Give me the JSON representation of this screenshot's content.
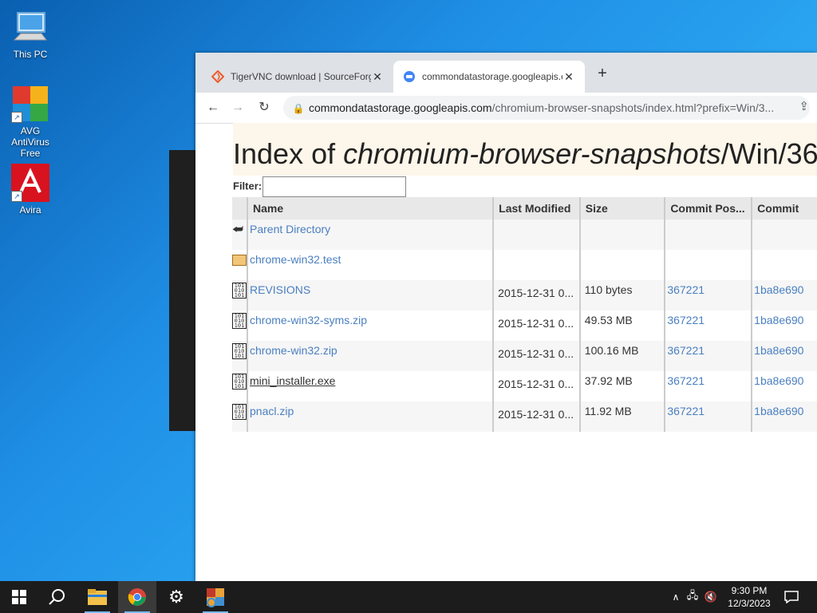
{
  "desktop": {
    "icons": [
      {
        "label": "This PC",
        "icon": "computer-icon"
      },
      {
        "label": "AVG AntiVirus Free",
        "icon": "avg-icon"
      },
      {
        "label": "Avira",
        "icon": "avira-icon"
      }
    ]
  },
  "browser": {
    "tabs": [
      {
        "title": "TigerVNC download | SourceForge",
        "icon": "sourceforge-icon",
        "active": false
      },
      {
        "title": "commondatastorage.googleapis.com",
        "icon": "globe-icon",
        "active": true
      }
    ],
    "address": {
      "host": "commondatastorage.googleapis.com",
      "path": "/chromium-browser-snapshots/index.html?prefix=Win/3..."
    },
    "page": {
      "title_prefix": "Index of ",
      "title_italic": "chromium-browser-snapshots",
      "title_suffix": "/Win/36",
      "filter_label": "Filter:",
      "filter_value": "",
      "columns": [
        "Name",
        "Last Modified",
        "Size",
        "Commit Pos...",
        "Commit"
      ],
      "rows": [
        {
          "icon": "back-arrow-icon",
          "name": "Parent Directory",
          "date": "",
          "size": "",
          "pos": "",
          "commit": ""
        },
        {
          "icon": "folder-icon",
          "name": "chrome-win32.test",
          "date": "",
          "size": "",
          "pos": "",
          "commit": ""
        },
        {
          "icon": "binary-file-icon",
          "name": "REVISIONS",
          "date": "2015-12-31 0...",
          "size": "110 bytes",
          "pos": "367221",
          "commit": "1ba8e690"
        },
        {
          "icon": "binary-file-icon",
          "name": "chrome-win32-syms.zip",
          "date": "2015-12-31 0...",
          "size": "49.53 MB",
          "pos": "367221",
          "commit": "1ba8e690"
        },
        {
          "icon": "binary-file-icon",
          "name": "chrome-win32.zip",
          "date": "2015-12-31 0...",
          "size": "100.16 MB",
          "pos": "367221",
          "commit": "1ba8e690"
        },
        {
          "icon": "binary-file-icon",
          "name": "mini_installer.exe",
          "date": "2015-12-31 0...",
          "size": "37.92 MB",
          "pos": "367221",
          "commit": "1ba8e690"
        },
        {
          "icon": "binary-file-icon",
          "name": "pnacl.zip",
          "date": "2015-12-31 0...",
          "size": "11.92 MB",
          "pos": "367221",
          "commit": "1ba8e690"
        }
      ]
    }
  },
  "taskbar": {
    "apps": [
      "start-icon",
      "search-icon",
      "file-explorer-icon",
      "chrome-icon",
      "settings-icon",
      "tigervnc-icon"
    ],
    "clock": {
      "time": "9:30 PM",
      "date": "12/3/2023"
    }
  },
  "colors": {
    "link": "#4a7fc0",
    "taskbar": "#1c1c1c",
    "header_band": "#fdf6ea"
  }
}
